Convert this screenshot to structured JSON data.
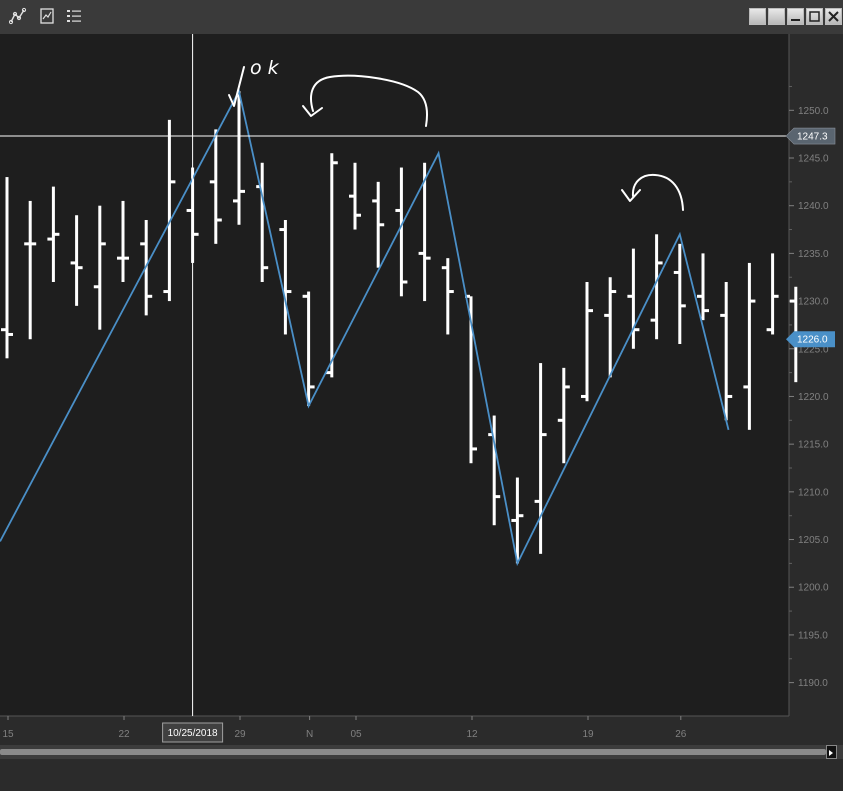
{
  "toolbar": {
    "icons": [
      "zigzag-line-icon",
      "chart-properties-icon",
      "list-icon"
    ]
  },
  "window_controls": [
    "restore-icon",
    "restore-icon",
    "minimize-icon",
    "maximize-icon",
    "close-icon"
  ],
  "colors": {
    "background": "#1e1e1e",
    "bar": "#ffffff",
    "zigzag": "#4a8fc7",
    "crosshair": "#ffffff",
    "last_price_tag": "#4a90c8",
    "crosshair_price_tag": "#5a6570"
  },
  "crosshair": {
    "price_label": "1247.3",
    "date_label": "10/25/2018"
  },
  "last_price": {
    "label": "1226.0",
    "value": 1226.0
  },
  "annotations": {
    "handwritten_text": "ok"
  },
  "chart_data": {
    "type": "ohlc",
    "y_axis": {
      "range": [
        1186.5,
        1258.0
      ],
      "ticks": [
        "1190.0",
        "1195.0",
        "1200.0",
        "1205.0",
        "1210.0",
        "1215.0",
        "1220.0",
        "1225.0",
        "1230.0",
        "1235.0",
        "1240.0",
        "1245.0",
        "1250.0"
      ],
      "tick_values": [
        1190,
        1195,
        1200,
        1205,
        1210,
        1215,
        1220,
        1225,
        1230,
        1235,
        1240,
        1245,
        1250
      ]
    },
    "x_axis": {
      "tick_labels": [
        "15",
        "22",
        "29",
        "N",
        "05",
        "12",
        "19",
        "26"
      ],
      "tick_bar_index": [
        0,
        5,
        10,
        13,
        15,
        20,
        25,
        29
      ]
    },
    "bars": [
      {
        "o": 1227.0,
        "h": 1243.0,
        "l": 1224.0,
        "c": 1226.5
      },
      {
        "o": 1236.0,
        "h": 1240.5,
        "l": 1226.0,
        "c": 1236.0
      },
      {
        "o": 1236.5,
        "h": 1242.0,
        "l": 1232.0,
        "c": 1237.0
      },
      {
        "o": 1234.0,
        "h": 1239.0,
        "l": 1229.5,
        "c": 1233.5
      },
      {
        "o": 1231.5,
        "h": 1240.0,
        "l": 1227.0,
        "c": 1236.0
      },
      {
        "o": 1234.5,
        "h": 1240.5,
        "l": 1232.0,
        "c": 1234.5
      },
      {
        "o": 1236.0,
        "h": 1238.5,
        "l": 1228.5,
        "c": 1230.5
      },
      {
        "o": 1231.0,
        "h": 1249.0,
        "l": 1230.0,
        "c": 1242.5
      },
      {
        "o": 1239.5,
        "h": 1244.0,
        "l": 1234.0,
        "c": 1237.0
      },
      {
        "o": 1242.5,
        "h": 1248.0,
        "l": 1236.0,
        "c": 1238.5
      },
      {
        "o": 1240.5,
        "h": 1252.0,
        "l": 1238.0,
        "c": 1241.5
      },
      {
        "o": 1242.0,
        "h": 1244.5,
        "l": 1232.0,
        "c": 1233.5
      },
      {
        "o": 1237.5,
        "h": 1238.5,
        "l": 1226.5,
        "c": 1231.0
      },
      {
        "o": 1230.5,
        "h": 1231.0,
        "l": 1219.0,
        "c": 1221.0
      },
      {
        "o": 1222.5,
        "h": 1245.5,
        "l": 1222.0,
        "c": 1244.5
      },
      {
        "o": 1241.0,
        "h": 1244.5,
        "l": 1237.5,
        "c": 1239.0
      },
      {
        "o": 1240.5,
        "h": 1242.5,
        "l": 1233.5,
        "c": 1238.0
      },
      {
        "o": 1239.5,
        "h": 1244.0,
        "l": 1230.5,
        "c": 1232.0
      },
      {
        "o": 1235.0,
        "h": 1244.5,
        "l": 1230.0,
        "c": 1234.5
      },
      {
        "o": 1233.5,
        "h": 1234.5,
        "l": 1226.5,
        "c": 1231.0
      },
      {
        "o": 1230.5,
        "h": 1230.5,
        "l": 1213.0,
        "c": 1214.5
      },
      {
        "o": 1216.0,
        "h": 1218.0,
        "l": 1206.5,
        "c": 1209.5
      },
      {
        "o": 1207.0,
        "h": 1211.5,
        "l": 1202.5,
        "c": 1207.5
      },
      {
        "o": 1209.0,
        "h": 1223.5,
        "l": 1203.5,
        "c": 1216.0
      },
      {
        "o": 1217.5,
        "h": 1223.0,
        "l": 1213.0,
        "c": 1221.0
      },
      {
        "o": 1220.0,
        "h": 1232.0,
        "l": 1219.5,
        "c": 1229.0
      },
      {
        "o": 1228.5,
        "h": 1232.5,
        "l": 1222.0,
        "c": 1231.0
      },
      {
        "o": 1230.5,
        "h": 1235.5,
        "l": 1225.0,
        "c": 1227.0
      },
      {
        "o": 1228.0,
        "h": 1237.0,
        "l": 1226.0,
        "c": 1234.0
      },
      {
        "o": 1233.0,
        "h": 1236.0,
        "l": 1225.5,
        "c": 1229.5
      },
      {
        "o": 1230.5,
        "h": 1235.0,
        "l": 1228.0,
        "c": 1229.0
      },
      {
        "o": 1228.5,
        "h": 1232.0,
        "l": 1217.5,
        "c": 1220.0
      },
      {
        "o": 1221.0,
        "h": 1234.0,
        "l": 1216.5,
        "c": 1230.0
      },
      {
        "o": 1227.0,
        "h": 1235.0,
        "l": 1226.5,
        "c": 1230.5
      },
      {
        "o": 1230.0,
        "h": 1231.5,
        "l": 1221.5,
        "c": 1226.0
      }
    ],
    "zigzag": [
      {
        "bar": -0.3,
        "price": 1204.8
      },
      {
        "bar": 10,
        "price": 1252.0
      },
      {
        "bar": 13,
        "price": 1219.0
      },
      {
        "bar": 18.6,
        "price": 1245.5
      },
      {
        "bar": 22,
        "price": 1202.5
      },
      {
        "bar": 29,
        "price": 1237.0
      },
      {
        "bar": 31.1,
        "price": 1216.5
      }
    ],
    "crosshair_price": 1247.3,
    "crosshair_bar": 8,
    "last_price": 1226.0
  }
}
